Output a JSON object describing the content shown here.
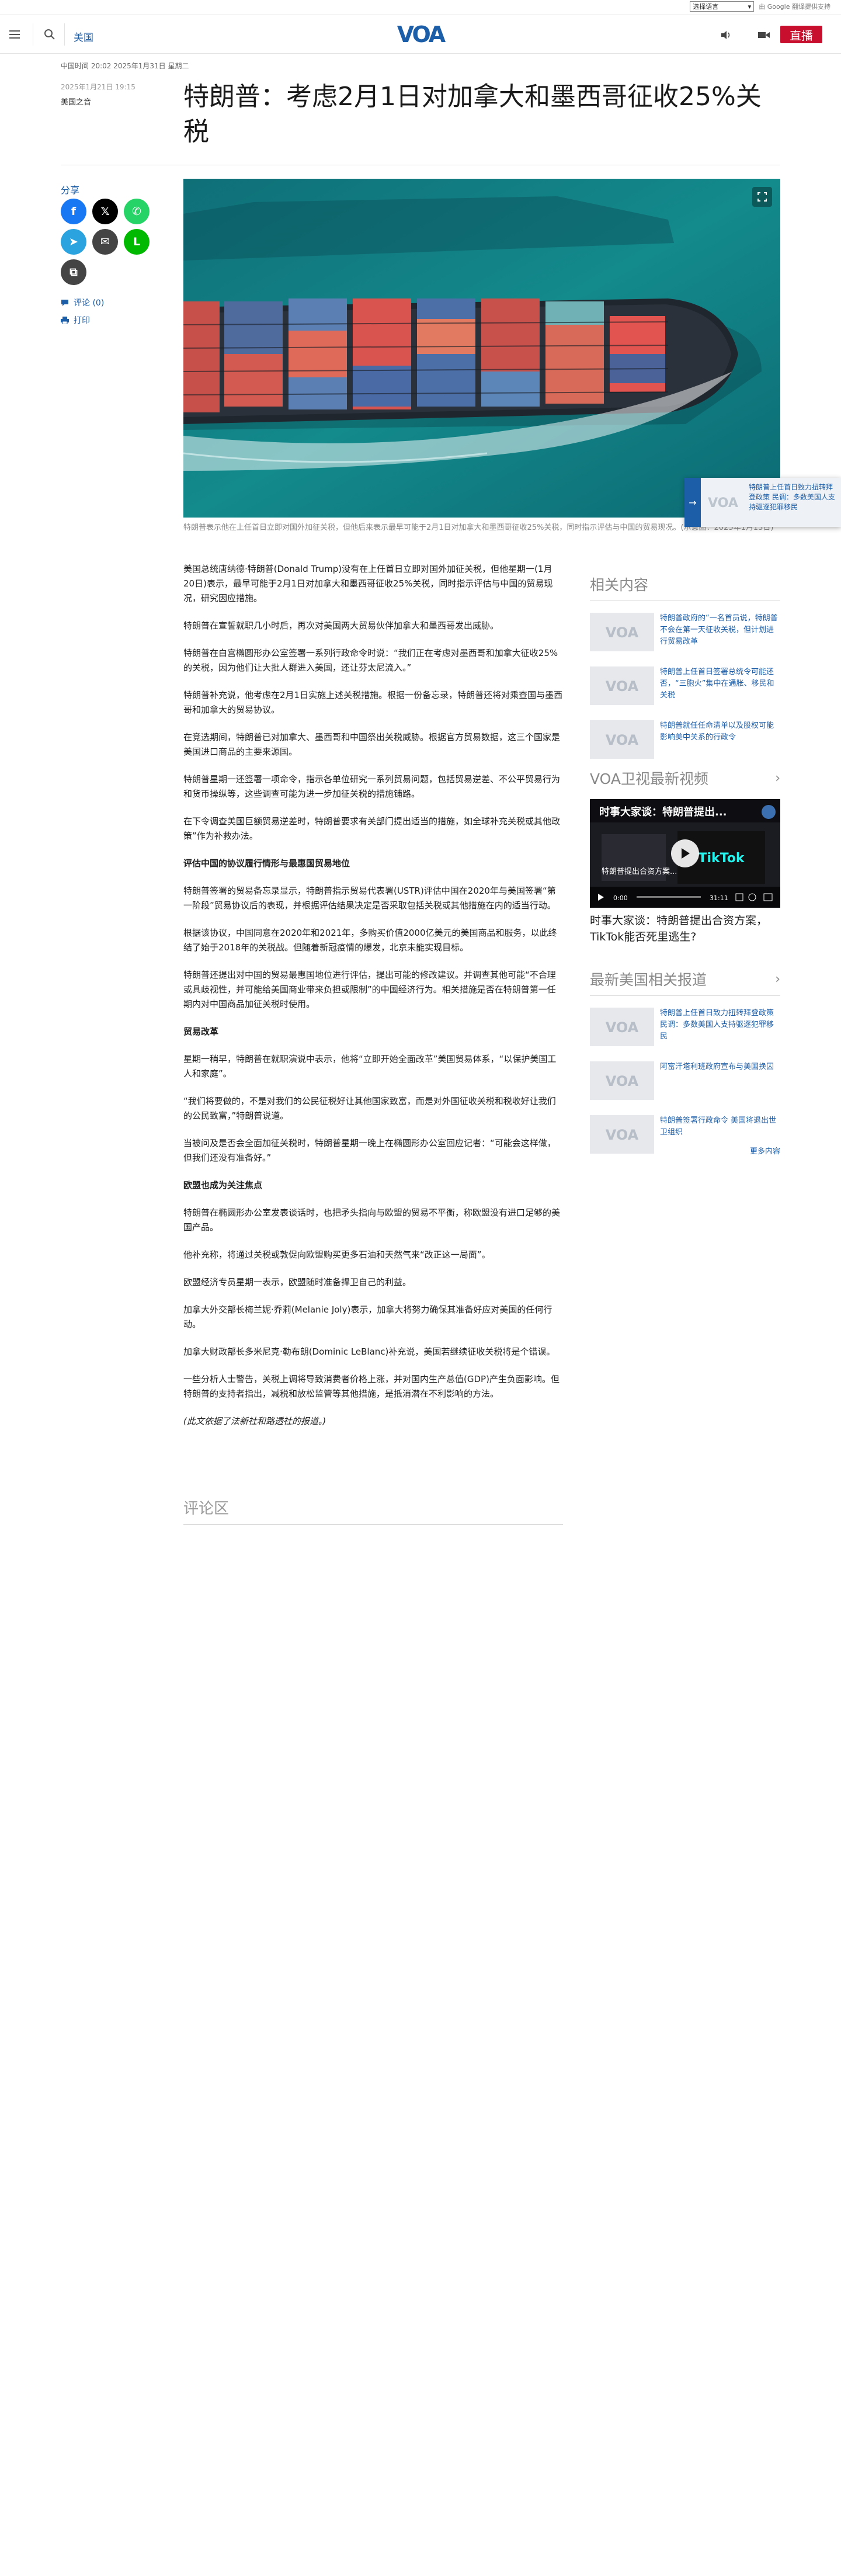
{
  "topbar": {
    "language_select": "选择语言",
    "powered_by": "由 Google 翻译提供支持"
  },
  "header": {
    "region": "美国",
    "live_label": "直播",
    "logo_text": "VOA"
  },
  "datebar": "中国时间 20:02 2025年1月31日 星期二",
  "article_meta": {
    "date": "2025年1月21日 19:15",
    "author": "美国之音"
  },
  "title": "特朗普：考虑2月1日对加拿大和墨西哥征收25%关税",
  "share": {
    "label": "分享",
    "buttons": [
      {
        "name": "facebook",
        "glyph": "f",
        "color": "#1877f2"
      },
      {
        "name": "x",
        "glyph": "𝕏",
        "color": "#000000"
      },
      {
        "name": "whatsapp",
        "glyph": "✆",
        "color": "#25d366"
      },
      {
        "name": "telegram",
        "glyph": "➤",
        "color": "#2aa3df"
      },
      {
        "name": "email",
        "glyph": "✉",
        "color": "#444444"
      },
      {
        "name": "line",
        "glyph": "L",
        "color": "#00b900"
      },
      {
        "name": "copy-link",
        "glyph": "⧉",
        "color": "#444444"
      }
    ],
    "comments_label": "评论 (0)",
    "print_label": "打印"
  },
  "hero_caption": "特朗普表示他在上任首日立即对国外加征关税，但他后来表示最早可能于2月1日对加拿大和墨西哥征收25%关税，同时指示评估与中国的贸易现况。(示意图：2025年1月13日)",
  "article": {
    "paragraphs": [
      {
        "type": "p",
        "text": "美国总统唐纳德·特朗普(Donald Trump)没有在上任首日立即对国外加征关税，但他星期一(1月20日)表示，最早可能于2月1日对加拿大和墨西哥征收25%关税，同时指示评估与中国的贸易现况，研究因应措施。"
      },
      {
        "type": "p",
        "text": "特朗普在宣誓就职几小时后，再次对美国两大贸易伙伴加拿大和墨西哥发出威胁。"
      },
      {
        "type": "p",
        "text": "特朗普在白宫椭圆形办公室签署一系列行政命令时说：“我们正在考虑对墨西哥和加拿大征收25%的关税，因为他们让大批人群进入美国，还让芬太尼流入。”"
      },
      {
        "type": "p",
        "text": "特朗普补充说，他考虑在2月1日实施上述关税措施。根据一份备忘录，特朗普还将对乘查国与墨西哥和加拿大的贸易协议。"
      },
      {
        "type": "p",
        "text": "在竞选期间，特朗普已对加拿大、墨西哥和中国祭出关税威胁。根据官方贸易数据，这三个国家是美国进口商品的主要来源国。"
      },
      {
        "type": "p",
        "text": "特朗普星期一还签署一项命令，指示各单位研究一系列贸易问题，包括贸易逆差、不公平贸易行为和货币操纵等，这些调查可能为进一步加征关税的措施铺路。"
      },
      {
        "type": "p",
        "text": "在下令调查美国巨额贸易逆差时，特朗普要求有关部门提出适当的措施，如全球补充关税或其他政策”作为补救办法。"
      },
      {
        "type": "h",
        "text": "评估中国的协议履行情形与最惠国贸易地位"
      },
      {
        "type": "p",
        "text": "特朗普签署的贸易备忘录显示，特朗普指示贸易代表署(USTR)评估中国在2020年与美国签署“第一阶段”贸易协议后的表现，并根据评估结果决定是否采取包括关税或其他措施在内的适当行动。"
      },
      {
        "type": "p",
        "text": "根据该协议，中国同意在2020年和2021年，多购买价值2000亿美元的美国商品和服务，以此终结了始于2018年的关税战。但随着新冠疫情的爆发，北京未能实现目标。"
      },
      {
        "type": "p",
        "text": "特朗普还提出对中国的贸易最惠国地位进行评估，提出可能的修改建议。并调查其他可能“不合理或具歧视性，并可能给美国商业带来负担或限制”的中国经济行为。相关措施是否在特朗普第一任期内对中国商品加征关税时使用。"
      },
      {
        "type": "h",
        "text": "贸易改革"
      },
      {
        "type": "p",
        "text": "星期一稍早，特朗普在就职演说中表示，他将“立即开始全面改革”美国贸易体系，“以保护美国工人和家庭”。"
      },
      {
        "type": "p",
        "text": "“我们将要做的，不是对我们的公民征税好让其他国家致富，而是对外国征收关税和税收好让我们的公民致富，”特朗普说道。"
      },
      {
        "type": "p",
        "text": "当被问及是否会全面加征关税时，特朗普星期一晚上在椭圆形办公室回应记者：“可能会这样做，但我们还没有准备好。”"
      },
      {
        "type": "h",
        "text": "欧盟也成为关注焦点"
      },
      {
        "type": "p",
        "text": "特朗普在椭圆形办公室发表谈话时，也把矛头指向与欧盟的贸易不平衡，称欧盟没有进口足够的美国产品。"
      },
      {
        "type": "p",
        "text": "他补充称，将通过关税或敦促向欧盟购买更多石油和天然气来“改正这一局面”。"
      },
      {
        "type": "p",
        "text": "欧盟经济专员星期一表示，欧盟随时准备捍卫自己的利益。"
      },
      {
        "type": "p",
        "text": "加拿大外交部长梅兰妮·乔莉(Melanie Joly)表示，加拿大将努力确保其准备好应对美国的任何行动。"
      },
      {
        "type": "p",
        "text": "加拿大财政部长多米尼克·勒布朗(Dominic LeBlanc)补充说，美国若继续征收关税将是个错误。"
      },
      {
        "type": "p",
        "text": "一些分析人士警告，关税上调将导致消费者价格上涨，并对国内生产总值(GDP)产生负面影响。但特朗普的支持者指出，减税和放松监管等其他措施，是抵消潜在不利影响的方法。"
      },
      {
        "type": "note",
        "text": "(此文依据了法新社和路透社的报道。)"
      }
    ]
  },
  "comments_heading": "评论区",
  "floating_card": {
    "text": "特朗普上任首日致力扭转拜登政策 民调：多数美国人支持驱逐犯罪移民"
  },
  "rail": {
    "related": {
      "heading": "相关内容",
      "items": [
        "特朗普政府的“一名首员说，特朗普不会在第一天征收关税，但计划进行贸易改革",
        "特朗普上任首日签署总统令可能还否，“三胞火”集中在通胀、移民和关税",
        "特朗普就任任命清单以及股权可能影响美中关系的行政令"
      ]
    },
    "video": {
      "heading": "VOA卫视最新视频",
      "overlay_title": "时事大家谈：特朗普提出...",
      "overlay_caption": "特朗普提出合资方案...",
      "brand": "TikTok",
      "time_current": "0:00",
      "time_total": "31:11",
      "title": "时事大家谈：特朗普提出合资方案，TikTok能否死里逃生?"
    },
    "latest": {
      "heading": "最新美国相关报道",
      "items": [
        "特朗普上任首日致力扭转拜登政策 民调：多数美国人支持驱逐犯罪移民",
        "阿富汗塔利班政府宣布与美国换囚",
        "特朗普签署行政命令 美国将退出世卫组织"
      ],
      "more": "更多内容"
    }
  }
}
